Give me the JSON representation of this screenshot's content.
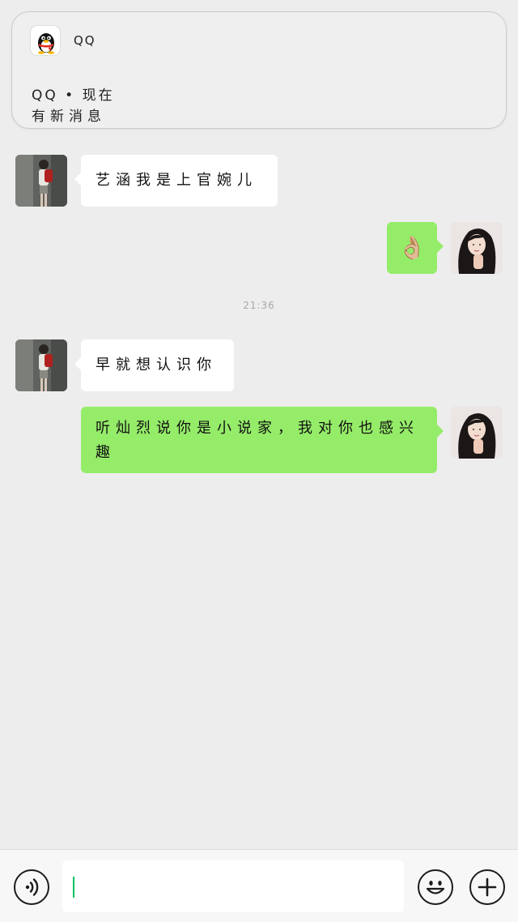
{
  "notification": {
    "app_name": "QQ",
    "sender_line": "QQ • 现在",
    "message_preview": "有新消息"
  },
  "chat": {
    "messages": [
      {
        "from": "other",
        "text": "艺涵我是上官婉儿"
      },
      {
        "from": "me",
        "emoji": "👌🏼"
      },
      {
        "from": "me",
        "text": "听灿烈说你是小说家，我对你也感兴趣"
      },
      {
        "from": "other",
        "text": "早就想认识你"
      }
    ],
    "timestamp": "21:36"
  },
  "input_bar": {
    "voice_icon": "voice-icon",
    "emoji_icon": "smiley-icon",
    "plus_icon": "plus-icon",
    "value": ""
  },
  "colors": {
    "background": "#ededed",
    "incoming_bubble": "#ffffff",
    "outgoing_bubble": "#95ec69",
    "cursor": "#07c160"
  }
}
